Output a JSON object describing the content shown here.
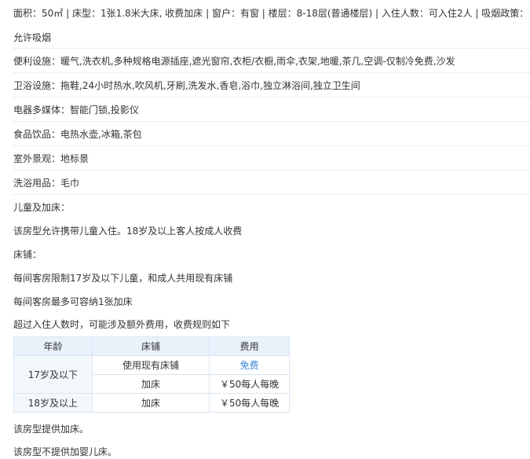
{
  "room_info": {
    "line1": "面积：50㎡ | 床型：1张1.8米大床, 收费加床 | 窗户：有窗 | 楼层：8-18层(普通楼层) | 入住人数：可入住2人 | 吸烟政策：",
    "line2": "允许吸烟"
  },
  "facilities": [
    "便利设施：暖气,洗衣机,多种规格电源插座,遮光窗帘,衣柜/衣橱,雨伞,衣架,地暖,茶几,空调-仅制冷免费,沙发",
    "卫浴设施：拖鞋,24小时热水,吹风机,牙刷,洗发水,香皂,浴巾,独立淋浴间,独立卫生间",
    "电器多媒体：智能门锁,投影仪",
    "食品饮品：电热水壶,冰箱,茶包",
    "室外景观：地标景",
    "洗浴用品：毛巾"
  ],
  "policy": {
    "children_heading": "儿童及加床：",
    "children_text": "该房型允许携带儿童入住。18岁及以上客人按成人收费",
    "bed_heading": "床铺：",
    "bed_line1": "每间客房限制17岁及以下儿童，和成人共用现有床铺",
    "bed_line2": "每间客房最多可容纳1张加床",
    "extra_fee_note": "超过入住人数时，可能涉及额外费用，收费规则如下",
    "extra_bed_provided": "该房型提供加床。",
    "crib_not_provided": "该房型不提供加婴儿床。"
  },
  "fee_table": {
    "headers": [
      "年龄",
      "床铺",
      "费用"
    ],
    "group1_age": "17岁及以下",
    "group1_rows": [
      {
        "bed": "使用现有床铺",
        "fee": "免费"
      },
      {
        "bed": "加床",
        "fee": "￥50每人每晚"
      }
    ],
    "group2_age": "18岁及以上",
    "group2_rows": [
      {
        "bed": "加床",
        "fee": "￥50每人每晚"
      }
    ]
  },
  "colors": {
    "text": "#333333",
    "free_link": "#3a86d6",
    "table_header_bg": "#e9f1fb",
    "table_border": "#d9e6f3",
    "separator": "#e6e6e6"
  }
}
